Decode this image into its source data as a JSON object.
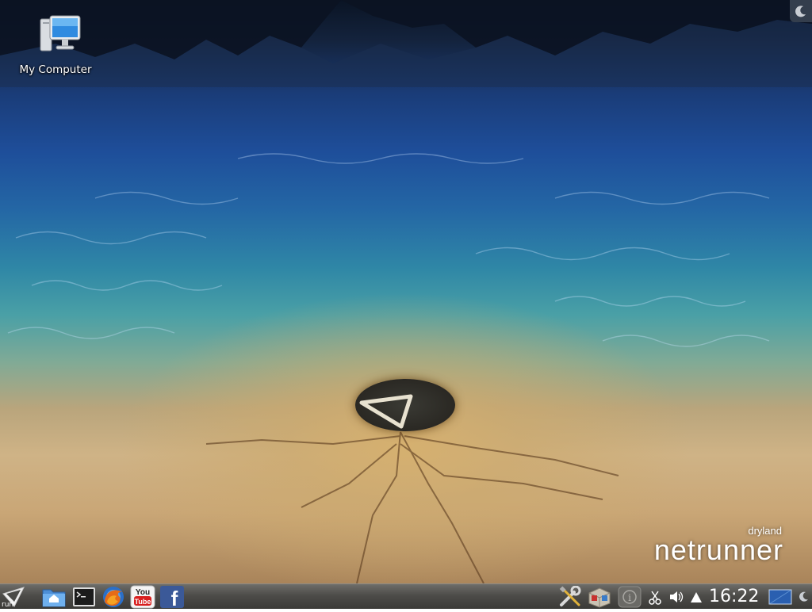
{
  "desktop": {
    "icons": [
      {
        "label": "My Computer",
        "icon": "computer-icon"
      }
    ],
    "wallpaper": {
      "brand_sub": "dryland",
      "brand_main": "netrunner"
    }
  },
  "panel": {
    "run_label": "run",
    "launchers": [
      {
        "name": "home-folder",
        "icon": "folder-home-icon"
      },
      {
        "name": "terminal",
        "icon": "terminal-icon"
      },
      {
        "name": "firefox",
        "icon": "firefox-icon"
      },
      {
        "name": "youtube",
        "icon": "youtube-icon",
        "text_top": "You",
        "text_bottom": "Tube"
      },
      {
        "name": "facebook",
        "icon": "facebook-icon",
        "text": "f"
      }
    ],
    "tray": [
      {
        "name": "system-settings",
        "icon": "tools-icon"
      },
      {
        "name": "package-manager",
        "icon": "package-icon"
      },
      {
        "name": "notifications",
        "icon": "info-icon",
        "text": "i"
      },
      {
        "name": "klipper",
        "icon": "scissors-icon"
      },
      {
        "name": "volume",
        "icon": "speaker-icon"
      },
      {
        "name": "expand-tray",
        "icon": "triangle-up-icon"
      }
    ],
    "clock": "16:22",
    "colors": {
      "panel_top": "#6e6d69",
      "panel_bottom": "#3b3a37",
      "accent_blue": "#2a5fb0"
    }
  }
}
